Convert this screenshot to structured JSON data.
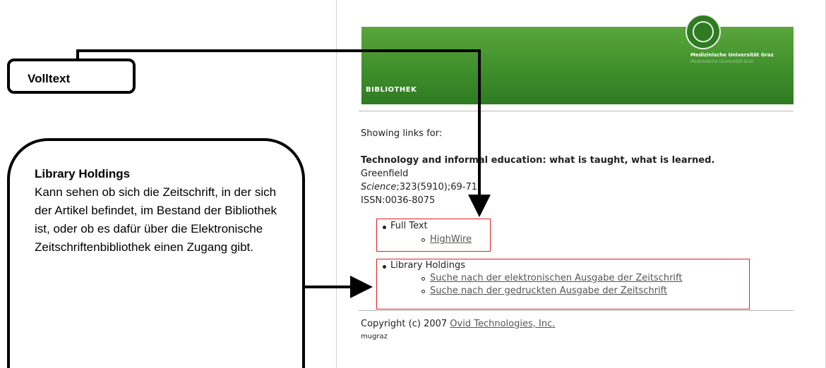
{
  "banner": {
    "label": "BIBLIOTHEK",
    "university": "Medizinische Universität Graz"
  },
  "results": {
    "showing": "Showing links for:",
    "title": "Technology and informal education: what is taught, what is learned.",
    "author": "Greenfield",
    "journal": "Science",
    "citation": ";323(5910);69-71",
    "issn": "ISSN:0036-8075"
  },
  "full_text": {
    "heading": "Full Text",
    "links": [
      "HighWire"
    ]
  },
  "library_holdings": {
    "heading": "Library Holdings",
    "links": [
      "Suche nach der elektronischen Ausgabe der Zeitschrift",
      "Suche nach der gedruckten Ausgabe der Zeitschrift"
    ]
  },
  "footer": {
    "copyright": "Copyright (c) 2007 ",
    "company_link": "Ovid Technologies, Inc.",
    "user": "mugraz"
  },
  "callouts": {
    "volltext": "Volltext",
    "holdings_title": "Library Holdings",
    "holdings_body": "Kann sehen ob sich die Zeitschrift, in der sich der Artikel befindet, im Bestand der Bibliothek ist, oder ob es dafür über die Elektronische Zeitschriftenbibliothek einen Zugang gibt."
  },
  "colors": {
    "banner_green": "#3f8f2c",
    "highlight_red": "#e0201c",
    "link_gray": "#555555"
  }
}
